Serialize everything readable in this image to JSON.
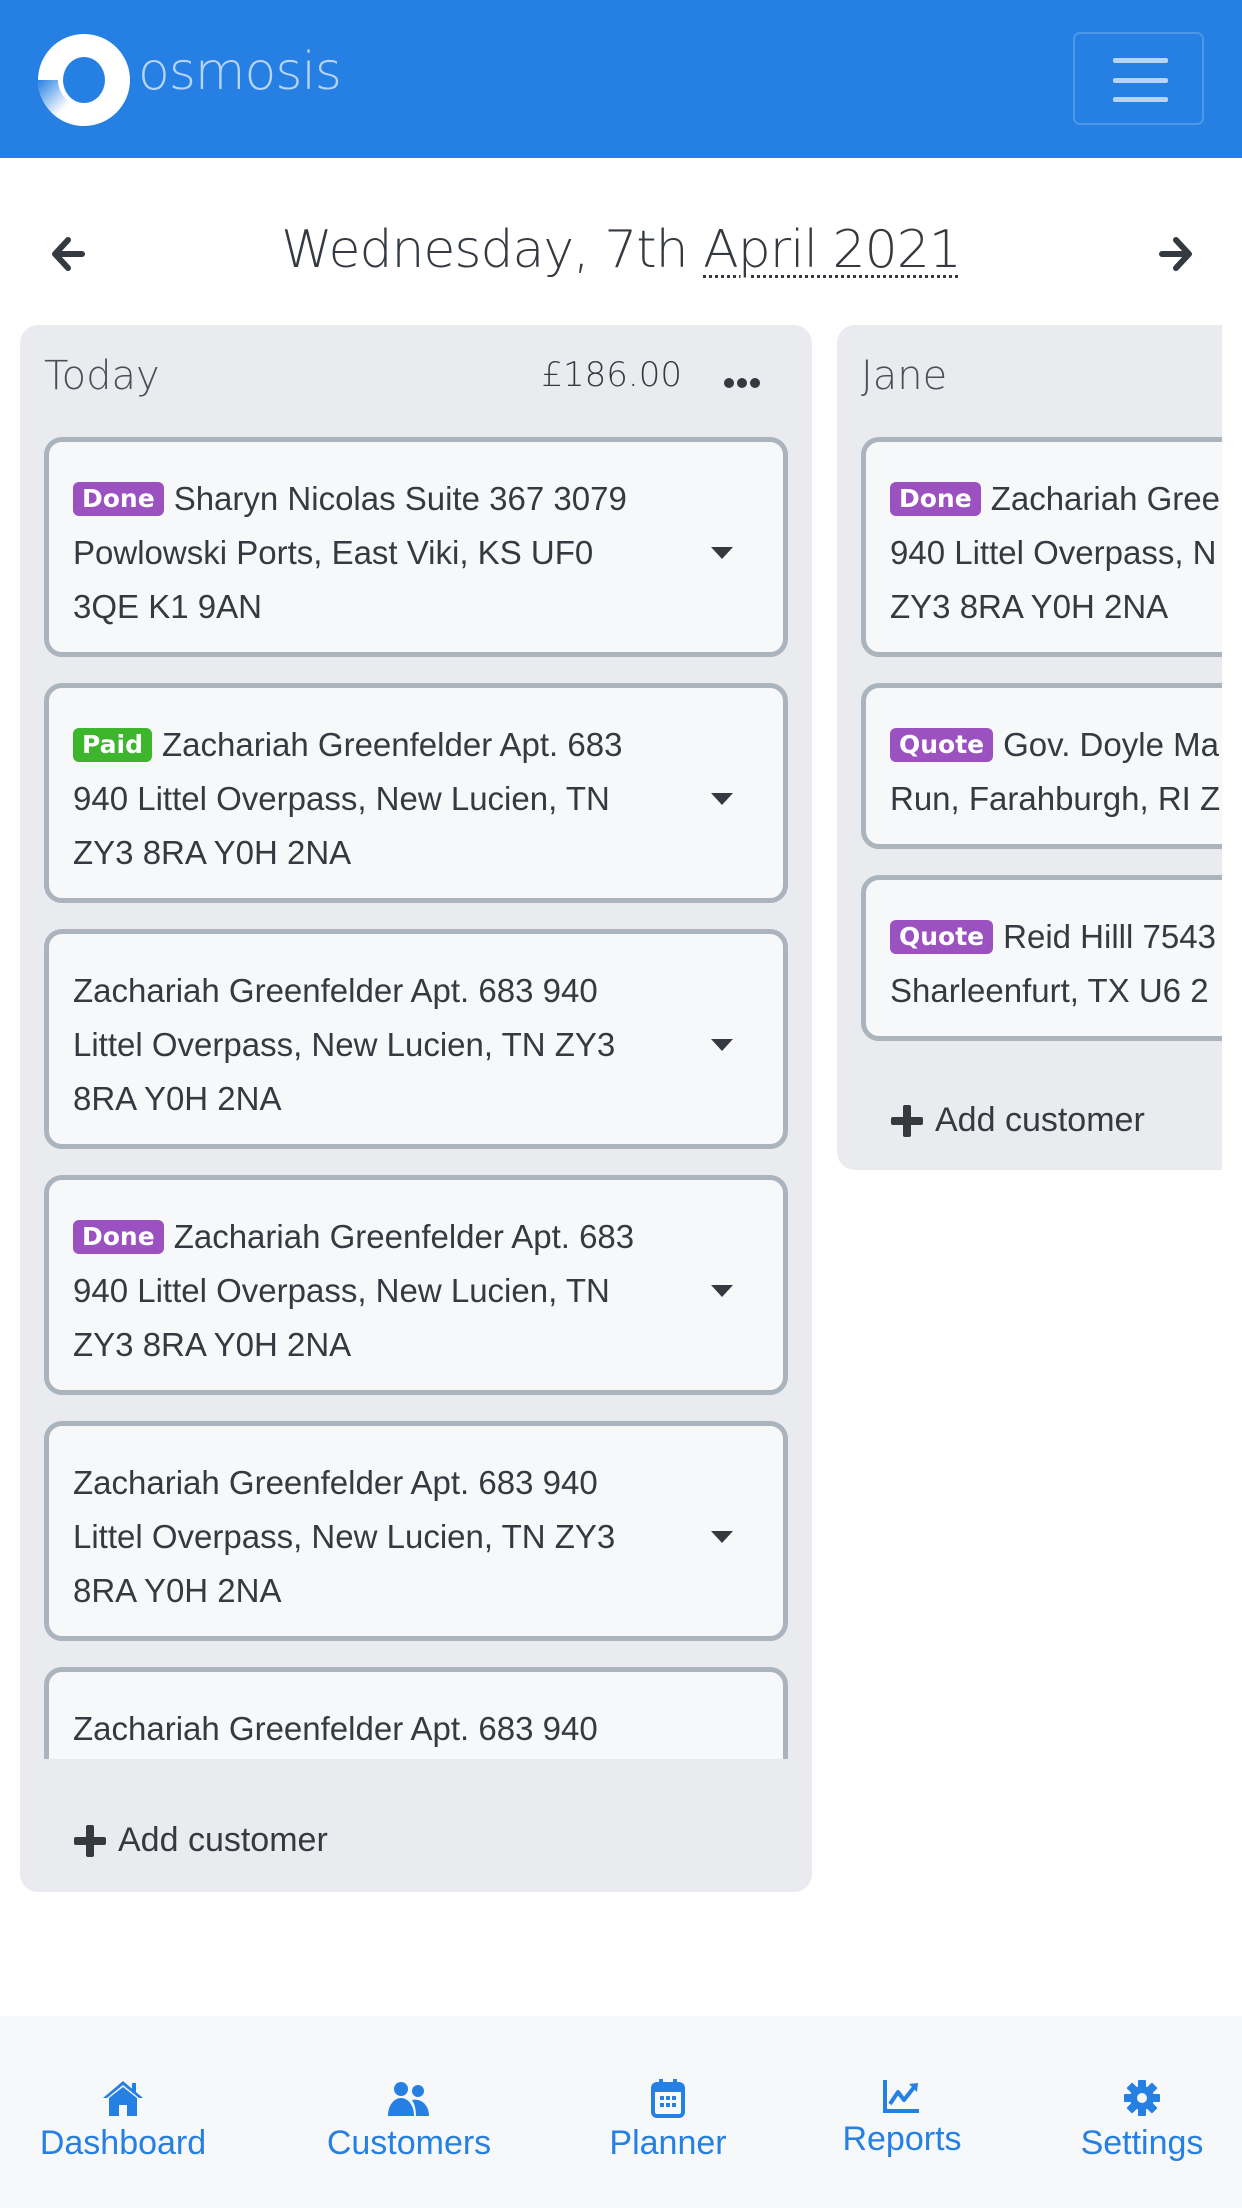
{
  "header": {
    "brand": "osmosis",
    "menu_icon": "hamburger-icon",
    "colors": {
      "primary": "#2680e3",
      "brand_text": "#b7d4f6"
    }
  },
  "date_nav": {
    "prev_icon": "arrow-left-icon",
    "next_icon": "arrow-right-icon",
    "title_prefix": "Wednesday, 7th ",
    "title_abbr": "April 2021"
  },
  "columns": [
    {
      "title": "Today",
      "total": "£186.00",
      "more_icon": "ellipsis-icon",
      "add_label": "Add customer",
      "cards": [
        {
          "badge": "Done",
          "badge_color": "#9b51bf",
          "text": "Sharyn Nicolas Suite 367 3079 Powlowski Ports, East Viki, KS UF0 3QE K1 9AN"
        },
        {
          "badge": "Paid",
          "badge_color": "#3db52c",
          "text": "Zachariah Greenfelder Apt. 683 940 Littel Overpass, New Lucien, TN ZY3 8RA Y0H 2NA"
        },
        {
          "badge": "",
          "text": "Zachariah Greenfelder Apt. 683 940 Littel Overpass, New Lucien, TN ZY3 8RA Y0H 2NA"
        },
        {
          "badge": "Done",
          "badge_color": "#9b51bf",
          "text": "Zachariah Greenfelder Apt. 683 940 Littel Overpass, New Lucien, TN ZY3 8RA Y0H 2NA"
        },
        {
          "badge": "",
          "text": "Zachariah Greenfelder Apt. 683 940 Littel Overpass, New Lucien, TN ZY3 8RA Y0H 2NA"
        },
        {
          "badge": "",
          "text": "Zachariah Greenfelder Apt. 683 940"
        }
      ]
    },
    {
      "title": "Jane",
      "add_label": "Add customer",
      "cards": [
        {
          "badge": "Done",
          "badge_color": "#9b51bf",
          "text": "Zachariah Gree",
          "line2": "940 Littel Overpass, N",
          "line3": "ZY3 8RA Y0H 2NA"
        },
        {
          "badge": "Quote",
          "badge_color": "#9b51bf",
          "text": "Gov. Doyle Ma",
          "line2": "Run, Farahburgh, RI Z"
        },
        {
          "badge": "Quote",
          "badge_color": "#9b51bf",
          "text": "Reid Hilll 7543",
          "line2": "Sharleenfurt, TX U6 2"
        }
      ]
    }
  ],
  "bottom_nav": [
    {
      "label": "Dashboard",
      "icon": "home-icon"
    },
    {
      "label": "Customers",
      "icon": "users-icon"
    },
    {
      "label": "Planner",
      "icon": "calendar-icon"
    },
    {
      "label": "Reports",
      "icon": "chart-line-icon"
    },
    {
      "label": "Settings",
      "icon": "gear-icon"
    }
  ]
}
